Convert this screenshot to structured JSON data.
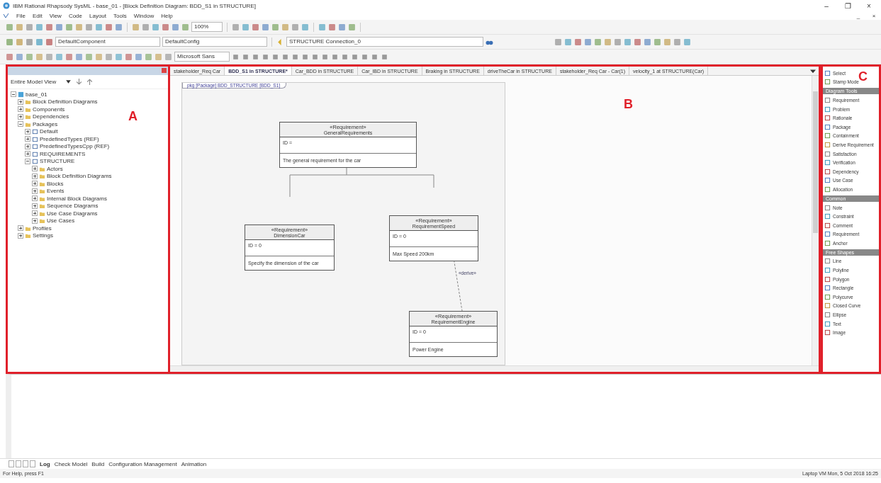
{
  "window": {
    "title": "IBM Rational Rhapsody SysML - base_01 - [Block Definition Diagram: BDD_S1 in STRUCTURE]",
    "controls": [
      "–",
      "❐",
      "×"
    ],
    "sub_controls": [
      "_",
      "×"
    ]
  },
  "menu": [
    "File",
    "Edit",
    "View",
    "Code",
    "Layout",
    "Tools",
    "Window",
    "Help"
  ],
  "toolbar": {
    "zoom": "100%",
    "component": "DefaultComponent",
    "config": "DefaultConfig",
    "search": "STRUCTURE Connection_0",
    "font": "Microsoft Sans"
  },
  "annotations": [
    "A",
    "B",
    "C"
  ],
  "browser": {
    "view": "Entire Model View",
    "tree": [
      {
        "label": "base_01",
        "kind": "project",
        "expanded": true,
        "children": [
          {
            "label": "Block Definition Diagrams",
            "kind": "folder",
            "expanded": false
          },
          {
            "label": "Components",
            "kind": "folder",
            "expanded": false
          },
          {
            "label": "Dependencies",
            "kind": "folder",
            "expanded": false
          },
          {
            "label": "Packages",
            "kind": "folder",
            "expanded": true,
            "children": [
              {
                "label": "Default",
                "kind": "package",
                "expanded": false
              },
              {
                "label": "PredefinedTypes (REF)",
                "kind": "package",
                "expanded": false
              },
              {
                "label": "PredefinedTypesCpp (REF)",
                "kind": "package",
                "expanded": false
              },
              {
                "label": "REQUIREMENTS",
                "kind": "package",
                "expanded": false
              },
              {
                "label": "STRUCTURE",
                "kind": "package",
                "expanded": true,
                "children": [
                  {
                    "label": "Actors",
                    "kind": "folder",
                    "expanded": false
                  },
                  {
                    "label": "Block Definition Diagrams",
                    "kind": "folder",
                    "expanded": false
                  },
                  {
                    "label": "Blocks",
                    "kind": "folder",
                    "expanded": false
                  },
                  {
                    "label": "Events",
                    "kind": "folder",
                    "expanded": false
                  },
                  {
                    "label": "Internal Block Diagrams",
                    "kind": "folder",
                    "expanded": false
                  },
                  {
                    "label": "Sequence Diagrams",
                    "kind": "folder",
                    "expanded": false
                  },
                  {
                    "label": "Use Case Diagrams",
                    "kind": "folder",
                    "expanded": false
                  },
                  {
                    "label": "Use Cases",
                    "kind": "folder",
                    "expanded": false
                  }
                ]
              }
            ]
          },
          {
            "label": "Profiles",
            "kind": "folder",
            "expanded": false
          },
          {
            "label": "Settings",
            "kind": "folder",
            "expanded": false
          }
        ]
      }
    ]
  },
  "tabs": [
    {
      "label": "stakeholder_Req Car",
      "selected": false
    },
    {
      "label": "BDD_S1 in STRUCTURE*",
      "selected": true
    },
    {
      "label": "Car_BDD in STRUCTURE",
      "selected": false
    },
    {
      "label": "Car_IBD in STRUCTURE",
      "selected": false
    },
    {
      "label": "Braking in STRUCTURE",
      "selected": false
    },
    {
      "label": "driveTheCar in STRUCTURE",
      "selected": false
    },
    {
      "label": "stakeholder_Req Car - Car(1)",
      "selected": false
    },
    {
      "label": "velocity_1 at STRUCTURE(Car)",
      "selected": false
    }
  ],
  "diagram": {
    "frame": "pkg [Package] BDD_STRUCTURE [BDD_S1]",
    "blocks": [
      {
        "stereotype": "«Requirement»",
        "name": "GeneralRequirements",
        "id": "ID = ",
        "text": "The general requirement for the car"
      },
      {
        "stereotype": "«Requirement»",
        "name": "DimensionCar",
        "id": "ID = 0",
        "text": "Specify the dimension of the car"
      },
      {
        "stereotype": "«Requirement»",
        "name": "RequirementSpeed",
        "id": "ID = 0",
        "text": "Max Speed 200km"
      },
      {
        "stereotype": "«Requirement»",
        "name": "RequirementEngine",
        "id": "ID = 0",
        "text": "Power Engine"
      }
    ],
    "derive_label": "«derive»"
  },
  "palette": [
    {
      "kind": "tool",
      "label": "Select"
    },
    {
      "kind": "tool",
      "label": "Stamp Mode"
    },
    {
      "kind": "section",
      "label": "Diagram Tools"
    },
    {
      "kind": "tool",
      "label": "Requirement"
    },
    {
      "kind": "tool",
      "label": "Problem"
    },
    {
      "kind": "tool",
      "label": "Rationale"
    },
    {
      "kind": "tool",
      "label": "Package"
    },
    {
      "kind": "tool",
      "label": "Containment"
    },
    {
      "kind": "tool",
      "label": "Derive Requirement"
    },
    {
      "kind": "tool",
      "label": "Satisfaction"
    },
    {
      "kind": "tool",
      "label": "Verification"
    },
    {
      "kind": "tool",
      "label": "Dependency"
    },
    {
      "kind": "tool",
      "label": "Use Case"
    },
    {
      "kind": "tool",
      "label": "Allocation"
    },
    {
      "kind": "section",
      "label": "Common"
    },
    {
      "kind": "tool",
      "label": "Note"
    },
    {
      "kind": "tool",
      "label": "Constraint"
    },
    {
      "kind": "tool",
      "label": "Comment"
    },
    {
      "kind": "tool",
      "label": "Requirement"
    },
    {
      "kind": "tool",
      "label": "Anchor"
    },
    {
      "kind": "section",
      "label": "Free Shapes"
    },
    {
      "kind": "tool",
      "label": "Line"
    },
    {
      "kind": "tool",
      "label": "Polyline"
    },
    {
      "kind": "tool",
      "label": "Polygon"
    },
    {
      "kind": "tool",
      "label": "Rectangle"
    },
    {
      "kind": "tool",
      "label": "Polycurve"
    },
    {
      "kind": "tool",
      "label": "Closed Curve"
    },
    {
      "kind": "tool",
      "label": "Ellipse"
    },
    {
      "kind": "tool",
      "label": "Text"
    },
    {
      "kind": "tool",
      "label": "Image"
    }
  ],
  "output_tabs": [
    {
      "label": "Log",
      "selected": true
    },
    {
      "label": "Check Model",
      "selected": false
    },
    {
      "label": "Build",
      "selected": false
    },
    {
      "label": "Configuration Management",
      "selected": false
    },
    {
      "label": "Animation",
      "selected": false
    }
  ],
  "status_bar": {
    "left": "For Help, press F1",
    "right": "Laptop VM   Mon, 5 Oct 2018   16:25"
  }
}
